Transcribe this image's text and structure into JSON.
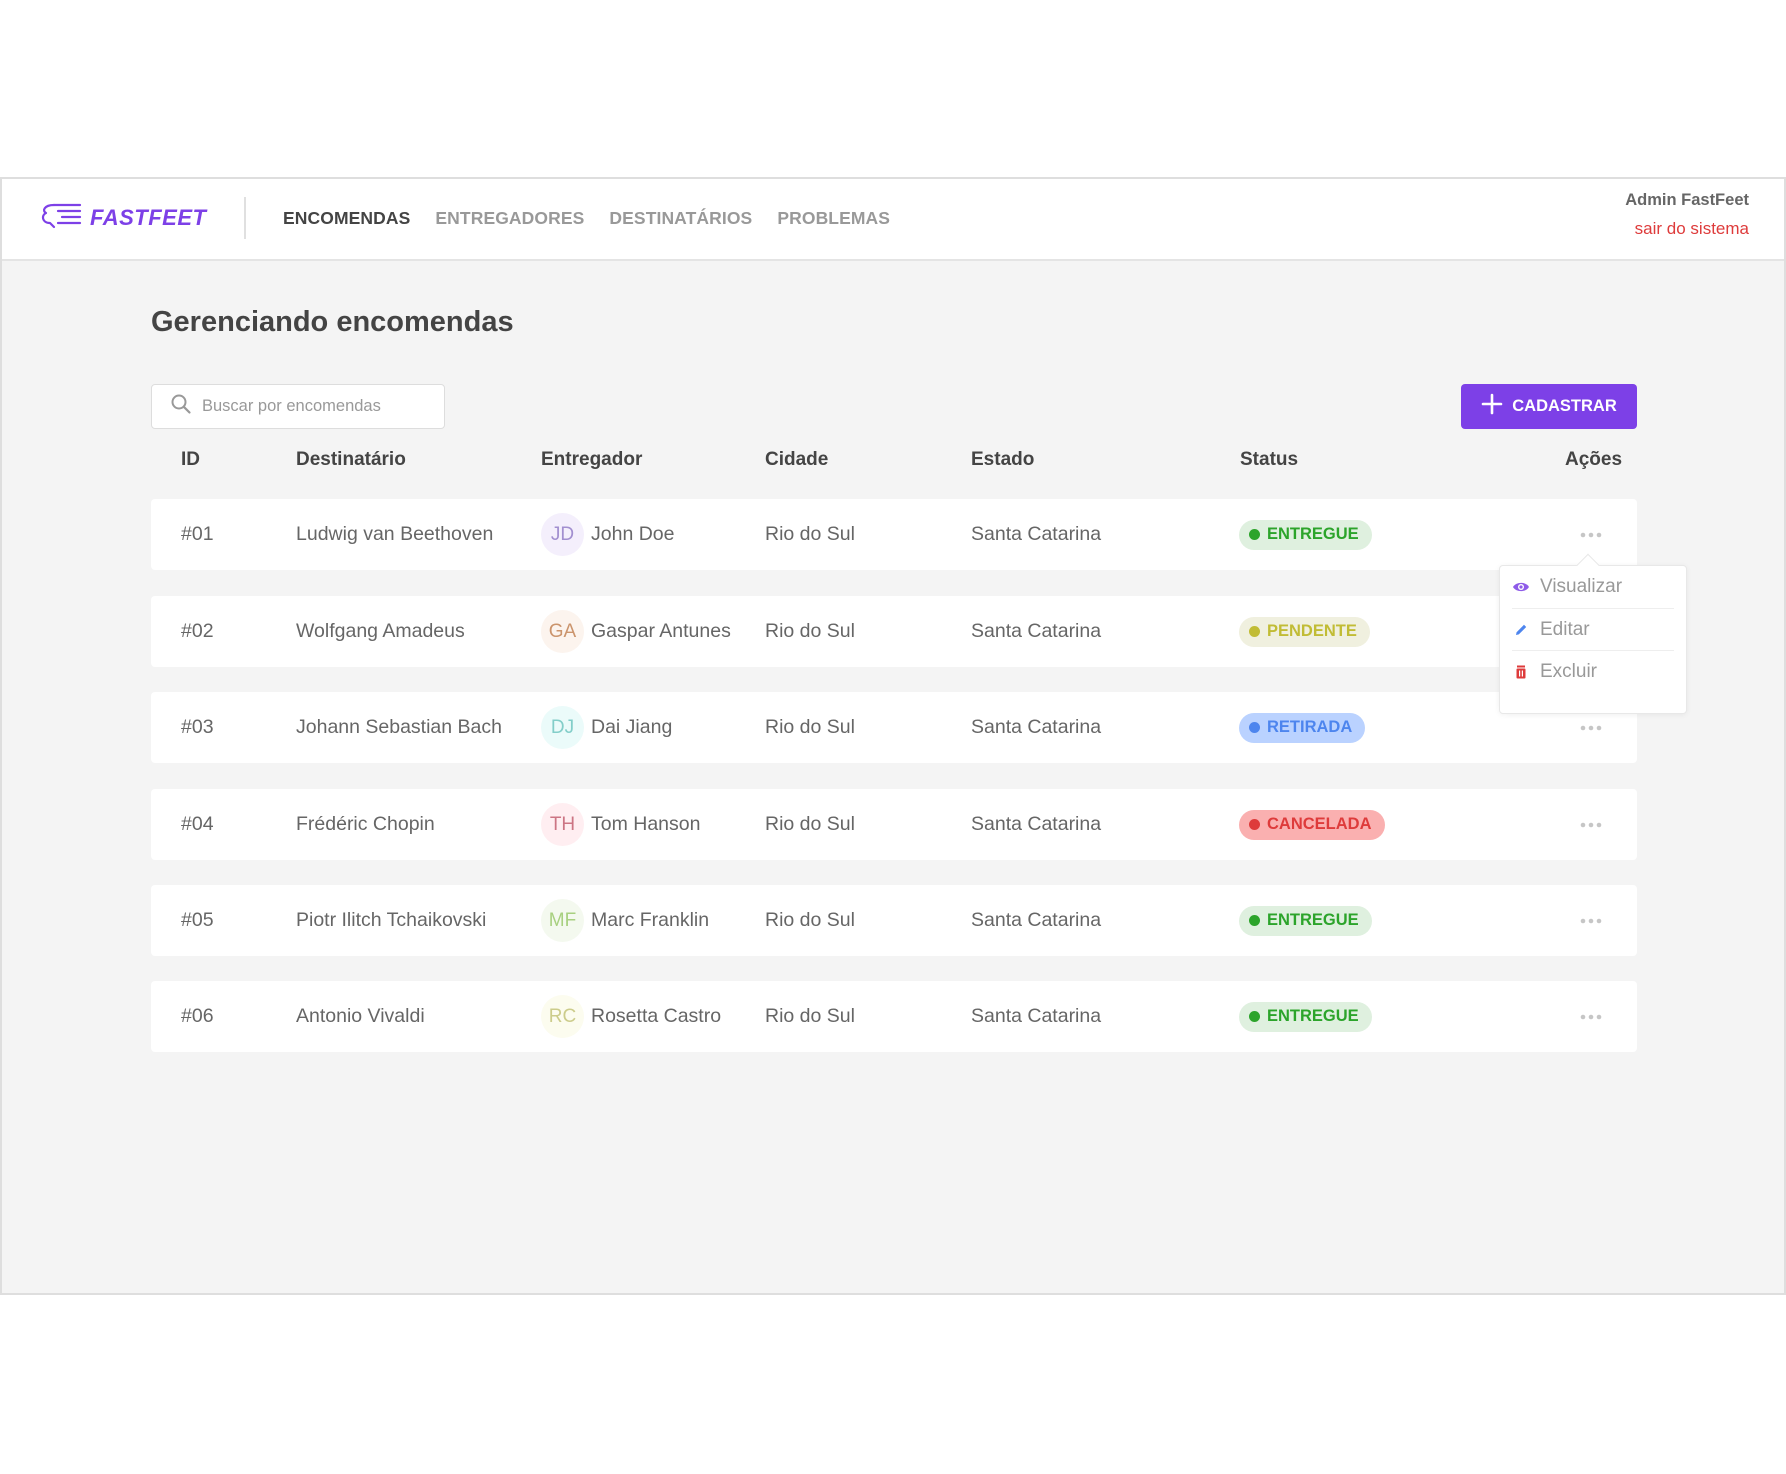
{
  "app": {
    "brand": "FASTFEET",
    "brand_color": "#7d40e7"
  },
  "nav": {
    "items": [
      {
        "label": "ENCOMENDAS",
        "active": true
      },
      {
        "label": "ENTREGADORES",
        "active": false
      },
      {
        "label": "DESTINATÁRIOS",
        "active": false
      },
      {
        "label": "PROBLEMAS",
        "active": false
      }
    ]
  },
  "profile": {
    "name": "Admin FastFeet",
    "logout_label": "sair do sistema",
    "logout_color": "#de3b3b"
  },
  "page": {
    "title": "Gerenciando encomendas"
  },
  "search": {
    "placeholder": "Buscar por encomendas",
    "value": "",
    "icon": "search-icon"
  },
  "add_button": {
    "label": "CADASTRAR",
    "icon": "plus-icon"
  },
  "table": {
    "columns": [
      "ID",
      "Destinatário",
      "Entregador",
      "Cidade",
      "Estado",
      "Status",
      "Ações"
    ],
    "rows": [
      {
        "id": "#01",
        "recipient": "Ludwig van Beethoven",
        "courier_initials": "JD",
        "courier": "John Doe",
        "city": "Rio do Sul",
        "state": "Santa Catarina",
        "status": "ENTREGUE"
      },
      {
        "id": "#02",
        "recipient": "Wolfgang Amadeus",
        "courier_initials": "GA",
        "courier": "Gaspar Antunes",
        "city": "Rio do Sul",
        "state": "Santa Catarina",
        "status": "PENDENTE"
      },
      {
        "id": "#03",
        "recipient": "Johann Sebastian Bach",
        "courier_initials": "DJ",
        "courier": "Dai Jiang",
        "city": "Rio do Sul",
        "state": "Santa Catarina",
        "status": "RETIRADA"
      },
      {
        "id": "#04",
        "recipient": "Frédéric Chopin",
        "courier_initials": "TH",
        "courier": "Tom Hanson",
        "city": "Rio do Sul",
        "state": "Santa Catarina",
        "status": "CANCELADA"
      },
      {
        "id": "#05",
        "recipient": "Piotr Ilitch Tchaikovski",
        "courier_initials": "MF",
        "courier": "Marc Franklin",
        "city": "Rio do Sul",
        "state": "Santa Catarina",
        "status": "ENTREGUE"
      },
      {
        "id": "#06",
        "recipient": "Antonio Vivaldi",
        "courier_initials": "RC",
        "courier": "Rosetta Castro",
        "city": "Rio do Sul",
        "state": "Santa Catarina",
        "status": "ENTREGUE"
      }
    ]
  },
  "avatar_colors": {
    "JD": {
      "bg": "#f4effc",
      "fg": "#a28fd0"
    },
    "GA": {
      "bg": "#fcf4ee",
      "fg": "#cb946c"
    },
    "DJ": {
      "bg": "#ebfbfa",
      "fg": "#83cec9"
    },
    "TH": {
      "bg": "#ffeef1",
      "fg": "#cc7584"
    },
    "MF": {
      "bg": "#f4f9ef",
      "fg": "#a8d080"
    },
    "RC": {
      "bg": "#fcfcef",
      "fg": "#cccc8b"
    }
  },
  "status_colors": {
    "ENTREGUE": {
      "bg": "#dff0df",
      "fg": "#2ca42b"
    },
    "PENDENTE": {
      "bg": "#f0f0df",
      "fg": "#c1bc35"
    },
    "RETIRADA": {
      "bg": "#bad2ff",
      "fg": "#4d85ee"
    },
    "CANCELADA": {
      "bg": "#fab0b0",
      "fg": "#de3b3b"
    }
  },
  "actions_menu": {
    "items": [
      {
        "label": "Visualizar",
        "icon": "eye-icon",
        "icon_color": "#8e5be8"
      },
      {
        "label": "Editar",
        "icon": "pencil-icon",
        "icon_color": "#4d85ee"
      },
      {
        "label": "Excluir",
        "icon": "trash-icon",
        "icon_color": "#de3b3b"
      }
    ]
  }
}
